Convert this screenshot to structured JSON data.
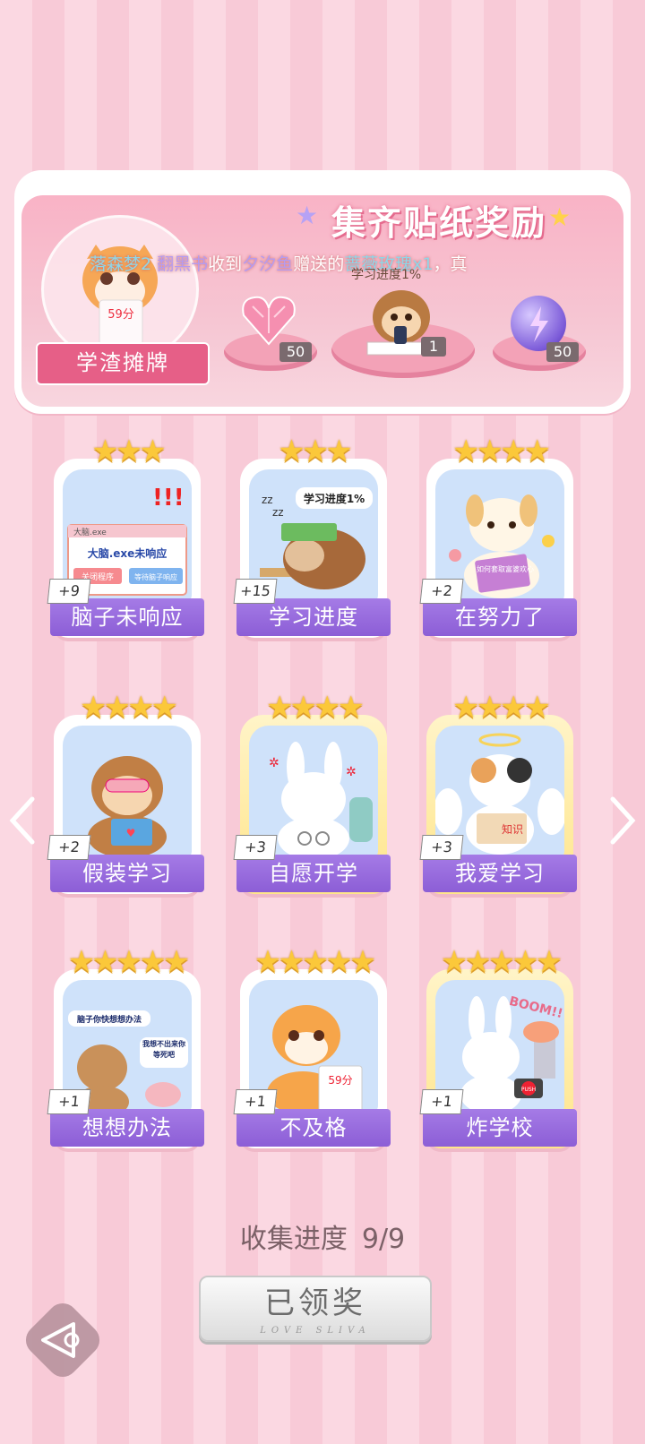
{
  "reward": {
    "title": "集齐贴纸奖励",
    "badge_label": "学渣摊牌",
    "ticker_parts": [
      "落森梦2 ",
      "翻黑书",
      "收到",
      "夕汐鱼",
      "赠送的",
      "蔷薇玫瑰x1",
      "，真"
    ],
    "items": [
      {
        "icon": "pink-heart-gem-icon",
        "count": "50"
      },
      {
        "icon": "monkey-sticker-icon",
        "count": "1",
        "sign": "学习进度1%"
      },
      {
        "icon": "purple-lightning-orb-icon",
        "count": "50"
      }
    ],
    "tiger_score": "59分"
  },
  "cards": [
    {
      "name": "脑子未响应",
      "bonus": "+9",
      "stars": 3,
      "gold": false,
      "icon": "brain-not-responding-window-icon",
      "window_title": "大脑.exe",
      "window_msg": "大脑.exe未响应",
      "btn_close": "关闭程序",
      "btn_wait": "等待脑子响应"
    },
    {
      "name": "学习进度",
      "bonus": "+15",
      "stars": 3,
      "gold": false,
      "icon": "sloth-sleeping-on-book-icon",
      "caption": "学习进度1%",
      "zz": "zz"
    },
    {
      "name": "在努力了",
      "bonus": "+2",
      "stars": 4,
      "gold": false,
      "icon": "puppy-reading-icon",
      "book_text": "如何套取富婆欢心"
    },
    {
      "name": "假装学习",
      "bonus": "+2",
      "stars": 4,
      "gold": false,
      "icon": "monkey-reading-icon"
    },
    {
      "name": "自愿开学",
      "bonus": "+3",
      "stars": 4,
      "gold": true,
      "icon": "bunny-handcuffed-icon"
    },
    {
      "name": "我爱学习",
      "bonus": "+3",
      "stars": 4,
      "gold": true,
      "icon": "angel-cat-reading-icon",
      "book_text": "知识"
    },
    {
      "name": "想想办法",
      "bonus": "+1",
      "stars": 5,
      "gold": false,
      "icon": "bear-and-brain-icon",
      "bubble1": "脑子你快想想办法",
      "bubble2": "我想不出来你等死吧"
    },
    {
      "name": "不及格",
      "bonus": "+1",
      "stars": 5,
      "gold": false,
      "icon": "tiger-failed-test-icon",
      "paper": "59分"
    },
    {
      "name": "炸学校",
      "bonus": "+1",
      "stars": 5,
      "gold": true,
      "icon": "bunny-boom-school-icon",
      "boom": "BOOM!!",
      "push": "PUSH"
    }
  ],
  "progress": {
    "label": "收集进度",
    "value": "9/9"
  },
  "claim": {
    "label": "已领奖",
    "sub": "LOVE SLIVA"
  },
  "colors": {
    "name_bar": "#8c5ed6",
    "star": "#fbc83a",
    "panel": "#f9b3c6"
  }
}
